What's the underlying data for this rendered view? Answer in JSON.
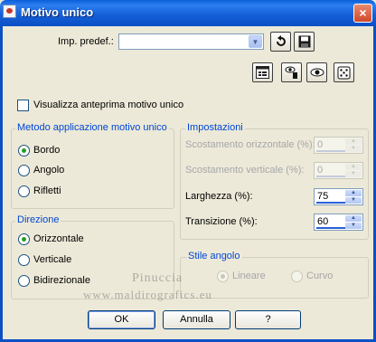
{
  "window": {
    "title": "Motivo unico",
    "close_glyph": "×"
  },
  "preset": {
    "label": "Imp. predef.:",
    "value": "",
    "icons": [
      "reset-icon",
      "save-icon"
    ]
  },
  "toolbar": {
    "icons": [
      "layout-icon",
      "eye-randomize-icon",
      "eye-icon",
      "dice-icon"
    ]
  },
  "preview_checkbox": {
    "label": "Visualizza anteprima motivo unico",
    "checked": false
  },
  "metodo": {
    "title": "Metodo applicazione motivo unico",
    "options": [
      {
        "label": "Bordo",
        "checked": true
      },
      {
        "label": "Angolo",
        "checked": false
      },
      {
        "label": "Rifletti",
        "checked": false
      }
    ]
  },
  "direzione": {
    "title": "Direzione",
    "options": [
      {
        "label": "Orizzontale",
        "checked": true
      },
      {
        "label": "Verticale",
        "checked": false
      },
      {
        "label": "Bidirezionale",
        "checked": false
      }
    ]
  },
  "impostazioni": {
    "title": "Impostazioni",
    "fields": [
      {
        "label": "Scostamento orizzontale (%):",
        "value": "0",
        "enabled": false
      },
      {
        "label": "Scostamento verticale (%):",
        "value": "0",
        "enabled": false
      },
      {
        "label": "Larghezza (%):",
        "value": "75",
        "enabled": true
      },
      {
        "label": "Transizione (%):",
        "value": "60",
        "enabled": true
      }
    ]
  },
  "stile_angolo": {
    "title": "Stile angolo",
    "options": [
      {
        "label": "Lineare",
        "checked": true,
        "enabled": false
      },
      {
        "label": "Curvo",
        "checked": false,
        "enabled": false
      }
    ]
  },
  "buttons": {
    "ok": "OK",
    "cancel": "Annulla",
    "help": "?"
  },
  "watermark": {
    "line1": "Pinuccia",
    "line2": "www.maldirografics.eu"
  },
  "colors": {
    "title_bar": "#0b4fc4",
    "face": "#ece9d8",
    "group_title": "#0046d5"
  }
}
